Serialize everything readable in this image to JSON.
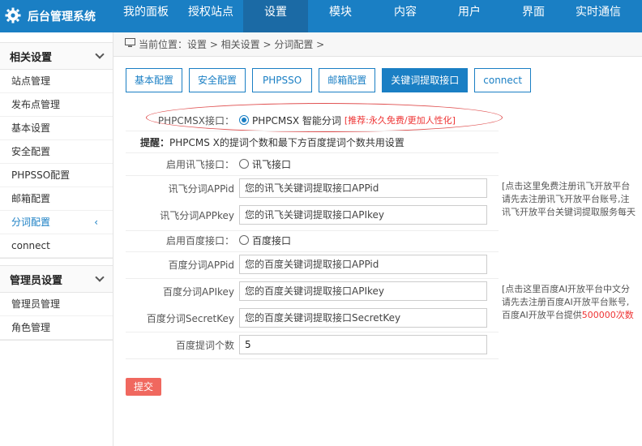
{
  "topbar": {
    "brand_title": "后台管理系统",
    "brand_icon": "gear-icon",
    "nav": [
      {
        "label": "我的面板"
      },
      {
        "label": "授权站点"
      },
      {
        "label": "设置"
      },
      {
        "label": "模块"
      },
      {
        "label": "内容"
      },
      {
        "label": "用户"
      },
      {
        "label": "界面"
      },
      {
        "label": "实时通信"
      }
    ],
    "active_index": 2
  },
  "sidebar": {
    "groups": [
      {
        "title": "相关设置",
        "items": [
          {
            "label": "站点管理"
          },
          {
            "label": "发布点管理"
          },
          {
            "label": "基本设置"
          },
          {
            "label": "安全配置"
          },
          {
            "label": "PHPSSO配置"
          },
          {
            "label": "邮箱配置"
          },
          {
            "label": "分词配置",
            "active": true,
            "arrow": "‹"
          },
          {
            "label": "connect"
          }
        ]
      },
      {
        "title": "管理员设置",
        "items": [
          {
            "label": "管理员管理"
          },
          {
            "label": "角色管理"
          }
        ]
      }
    ]
  },
  "breadcrumb": {
    "text": "当前位置：设置 > 相关设置 > 分词配置 >"
  },
  "tabs": [
    {
      "label": "基本配置"
    },
    {
      "label": "安全配置"
    },
    {
      "label": "PHPSSO"
    },
    {
      "label": "邮箱配置"
    },
    {
      "label": "关键词提取接口",
      "active": true
    },
    {
      "label": "connect"
    }
  ],
  "form": {
    "phpcmsx": {
      "label": "PHPCMSX接口：",
      "option": "PHPCMSX 智能分词",
      "note": "[推荐:永久免费/更加人性化]"
    },
    "notice": {
      "prefix": "提醒：",
      "text": "PHPCMS X的提词个数和最下方百度提词个数共用设置"
    },
    "xunfei_enable": {
      "label": "启用讯飞接口：",
      "option": "讯飞接口"
    },
    "xunfei_appid": {
      "label": "讯飞分词APPid",
      "placeholder": "您的讯飞关键词提取接口APPid"
    },
    "xunfei_appkey": {
      "label": "讯飞分词APPkey",
      "placeholder": "您的讯飞关键词提取接口APIkey"
    },
    "xunfei_tip": {
      "line1": "[点击这里免费注册讯飞开放平台",
      "line2": "请先去注册讯飞开放平台账号,注",
      "line3": "讯飞开放平台关键词提取服务每天"
    },
    "baidu_enable": {
      "label": "启用百度接口：",
      "option": "百度接口"
    },
    "baidu_appid": {
      "label": "百度分词APPid",
      "placeholder": "您的百度关键词提取接口APPid"
    },
    "baidu_apikey": {
      "label": "百度分词APIkey",
      "placeholder": "您的百度关键词提取接口APIkey"
    },
    "baidu_secret": {
      "label": "百度分词SecretKey",
      "placeholder": "您的百度关键词提取接口SecretKey"
    },
    "baidu_tip": {
      "line1": "[点击这里百度AI开放平台中文分",
      "line2": "请先去注册百度AI开放平台账号,",
      "line3_pre": "百度AI开放平台提供",
      "line3_hl": "500000次数"
    },
    "baidu_count": {
      "label": "百度提词个数",
      "value": "5"
    }
  },
  "submit_label": "提交",
  "colors": {
    "primary": "#1a7fc4",
    "danger": "#f0685f",
    "highlight": "#e33333"
  }
}
